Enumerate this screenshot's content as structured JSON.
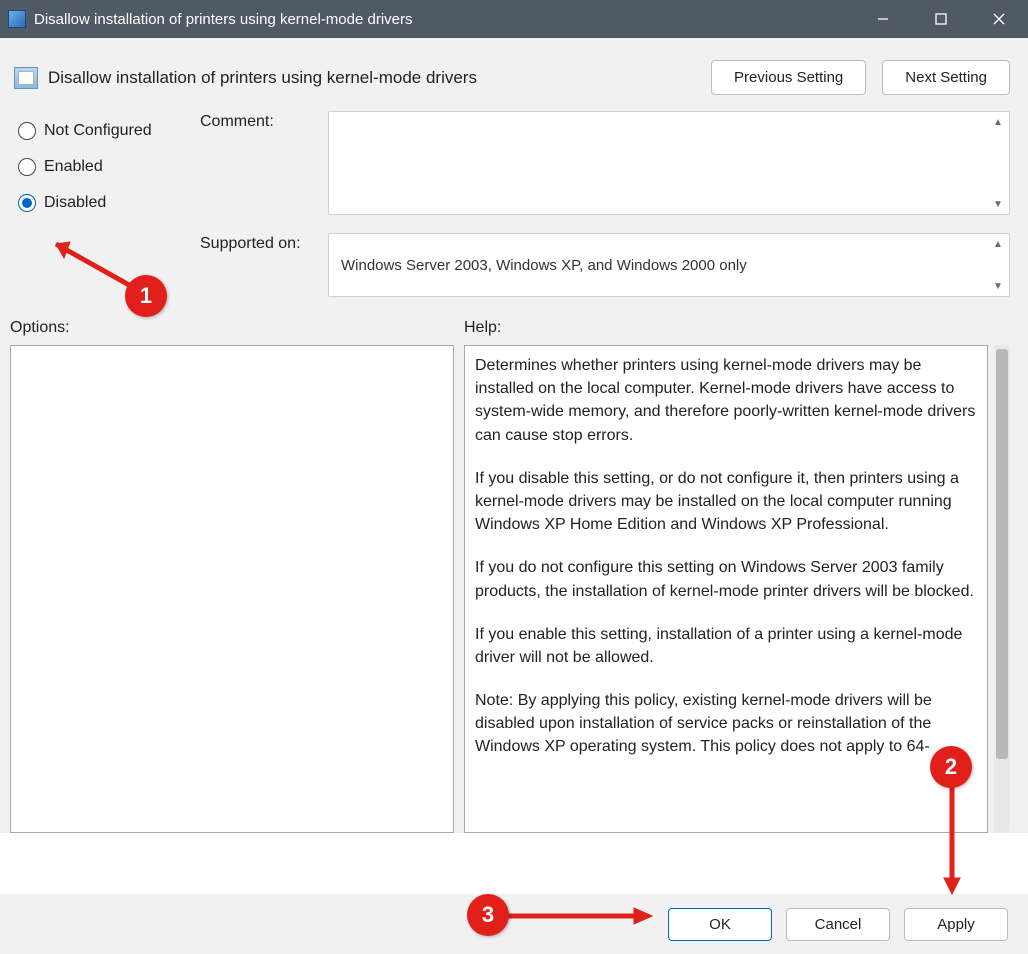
{
  "titlebar": {
    "title": "Disallow installation of printers using kernel-mode drivers"
  },
  "header": {
    "title": "Disallow installation of printers using kernel-mode drivers",
    "prev_btn": "Previous Setting",
    "next_btn": "Next Setting"
  },
  "radios": {
    "not_configured": "Not Configured",
    "enabled": "Enabled",
    "disabled": "Disabled",
    "selected": "disabled"
  },
  "fields": {
    "comment_label": "Comment:",
    "comment_value": "",
    "supported_label": "Supported on:",
    "supported_value": "Windows Server 2003, Windows XP, and Windows 2000 only"
  },
  "labels": {
    "options": "Options:",
    "help": "Help:"
  },
  "help_paragraphs": [
    "Determines whether printers using kernel-mode drivers may be installed on the local computer.  Kernel-mode drivers have access to system-wide memory, and therefore poorly-written kernel-mode drivers can cause stop errors.",
    "If you disable this setting, or do not configure it, then printers using a kernel-mode drivers may be installed on the local computer running Windows XP Home Edition and Windows XP Professional.",
    "If you do not configure this setting on Windows Server 2003 family products, the installation of kernel-mode printer drivers will be blocked.",
    "If you enable this setting, installation of a printer using a kernel-mode driver will not be allowed.",
    "Note: By applying this policy, existing kernel-mode drivers will be disabled upon installation of service packs or reinstallation of the Windows XP operating system. This policy does not apply to 64-"
  ],
  "footer": {
    "ok": "OK",
    "cancel": "Cancel",
    "apply": "Apply"
  },
  "annotations": {
    "b1": "1",
    "b2": "2",
    "b3": "3"
  }
}
